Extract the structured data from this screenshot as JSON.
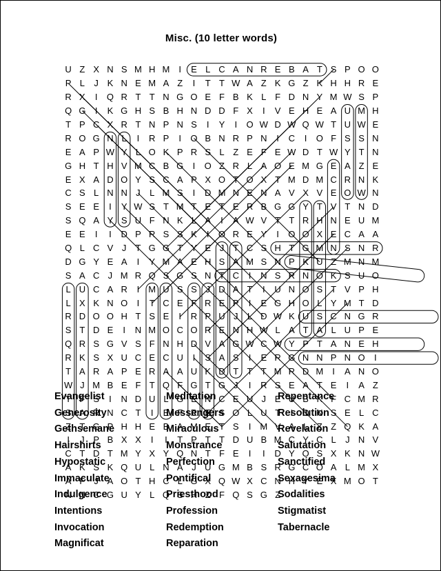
{
  "page": {
    "title": "Misc. (10 letter words)",
    "border_color": "#000000",
    "background_color": "#ffffff",
    "text_color": "#000000"
  },
  "grid": {
    "rows": 23,
    "columns": 23,
    "letters": [
      [
        "U",
        "Z",
        "X",
        "N",
        "S",
        "M",
        "H",
        "M",
        "I",
        "E",
        "L",
        "C",
        "A",
        "N",
        "R",
        "E",
        "B",
        "A",
        "T",
        "S",
        "P",
        "O",
        "O"
      ],
      [
        "N",
        "E",
        "M",
        "A",
        "Z",
        "I",
        "T",
        "T",
        "W",
        "A",
        "Z",
        "K",
        "G",
        "Z",
        "K",
        "H",
        "H",
        "R",
        "E",
        "R",
        "X",
        "I",
        "Q"
      ],
      [
        "G",
        "O",
        "E",
        "F",
        "B",
        "K",
        "L",
        "F",
        "D",
        "N",
        "Y",
        "M",
        "W",
        "S",
        "P",
        "Q",
        "G",
        "I",
        "K",
        "G",
        "H",
        "S",
        "B"
      ],
      [
        "F",
        "X",
        "I",
        "V",
        "E",
        "H",
        "E",
        "A",
        "U",
        "M",
        "H",
        "T",
        "P",
        "C",
        "X",
        "R",
        "T",
        "N",
        "P",
        "N",
        "S",
        "I",
        "Y"
      ],
      [
        "W",
        "Q",
        "W",
        "T",
        "U",
        "W",
        "E",
        "R",
        "O",
        "G",
        "N",
        "L",
        "I",
        "R",
        "P",
        "I",
        "O",
        "B",
        "N",
        "R",
        "P",
        "N",
        "I"
      ],
      [
        "S",
        "S",
        "N",
        "E",
        "A",
        "P",
        "W",
        "Y",
        "L",
        "O",
        "K",
        "P",
        "R",
        "S",
        "L",
        "Z",
        "E",
        "F",
        "E",
        "W",
        "D",
        "T",
        "W"
      ],
      [
        "H",
        "T",
        "H",
        "V",
        "M",
        "C",
        "B",
        "G",
        "I",
        "O",
        "Z",
        "R",
        "L",
        "A",
        "O",
        "E",
        "M",
        "G",
        "E",
        "A",
        "Z",
        "E",
        "E"
      ],
      [
        "Y",
        "S",
        "C",
        "A",
        "P",
        "X",
        "O",
        "T",
        "O",
        "X",
        "T",
        "M",
        "D",
        "M",
        "C",
        "R",
        "N",
        "K",
        "C",
        "S",
        "L",
        "N",
        "N"
      ],
      [
        "I",
        "D",
        "M",
        "N",
        "E",
        "N",
        "A",
        "V",
        "X",
        "V",
        "E",
        "O",
        "W",
        "N",
        "S",
        "E",
        "E",
        "I",
        "Y",
        "W",
        "S",
        "T",
        "M"
      ],
      [
        "R",
        "B",
        "G",
        "G",
        "Y",
        "T",
        "V",
        "T",
        "N",
        "D",
        "S",
        "Q",
        "A",
        "Y",
        "S",
        "U",
        "F",
        "N",
        "K",
        "L",
        "A",
        "I",
        "A"
      ],
      [
        "R",
        "H",
        "N",
        "E",
        "U",
        "M",
        "E",
        "E",
        "I",
        "I",
        "D",
        "P",
        "R",
        "S",
        "S",
        "K",
        "I",
        "O",
        "R",
        "E",
        "Y",
        "I",
        "O"
      ],
      [
        "A",
        "A",
        "Q",
        "L",
        "C",
        "V",
        "J",
        "T",
        "G",
        "G",
        "T",
        "Y",
        "E",
        "J",
        "T",
        "C",
        "S",
        "H",
        "T",
        "G",
        "M",
        "N",
        "S"
      ],
      [
        "Y",
        "E",
        "A",
        "I",
        "Y",
        "M",
        "A",
        "E",
        "H",
        "S",
        "A",
        "M",
        "S",
        "N",
        "P",
        "K",
        "U",
        "Z",
        "M",
        "N",
        "M",
        "S",
        "A"
      ],
      [
        "Q",
        "S",
        "G",
        "S",
        "N",
        "T",
        "C",
        "I",
        "N",
        "S",
        "R",
        "N",
        "O",
        "K",
        "S",
        "U",
        "O",
        "L",
        "U",
        "C",
        "A",
        "R",
        "I"
      ],
      [
        "J",
        "D",
        "A",
        "T",
        "I",
        "U",
        "N",
        "O",
        "S",
        "T",
        "V",
        "P",
        "H",
        "L",
        "X",
        "K",
        "N",
        "O",
        "I",
        "T",
        "C",
        "E",
        "F"
      ],
      [
        "E",
        "G",
        "H",
        "O",
        "L",
        "Y",
        "M",
        "T",
        "D",
        "R",
        "D",
        "O",
        "O",
        "H",
        "T",
        "S",
        "E",
        "I",
        "R",
        "P",
        "U",
        "J",
        "L"
      ],
      [
        "S",
        "C",
        "N",
        "G",
        "R",
        "S",
        "T",
        "D",
        "E",
        "I",
        "N",
        "M",
        "O",
        "C",
        "O",
        "R",
        "E",
        "N",
        "H",
        "W",
        "L",
        "A",
        "T"
      ],
      [
        "E",
        "Q",
        "R",
        "S",
        "G",
        "V",
        "S",
        "F",
        "N",
        "H",
        "D",
        "V",
        "A",
        "G",
        "W",
        "C",
        "W",
        "Y",
        "P",
        "T",
        "A",
        "N",
        "E"
      ],
      [
        "X",
        "U",
        "C",
        "E",
        "C",
        "U",
        "I",
        "S",
        "A",
        "S",
        "I",
        "E",
        "R",
        "G",
        "N",
        "N",
        "P",
        "N",
        "O",
        "I",
        "T",
        "A",
        "R"
      ],
      [
        "A",
        "A",
        "U",
        "K",
        "D",
        "T",
        "T",
        "T",
        "M",
        "R",
        "D",
        "M",
        "I",
        "A",
        "N",
        "O",
        "W",
        "J",
        "M",
        "B",
        "E",
        "F",
        "T"
      ],
      [
        "G",
        "J",
        "I",
        "R",
        "S",
        "E",
        "A",
        "T",
        "E",
        "I",
        "A",
        "Z",
        "T",
        "F",
        "S",
        "I",
        "N",
        "D",
        "U",
        "L",
        "G",
        "E",
        "N"
      ],
      [
        "E",
        "U",
        "B",
        "K",
        "F",
        "C",
        "M",
        "R",
        "S",
        "A",
        "R",
        "N",
        "C",
        "T",
        "I",
        "E",
        "F",
        "R",
        "E",
        "S",
        "O",
        "L",
        "U"
      ],
      [
        "S",
        "E",
        "L",
        "C",
        "Z",
        "T",
        "G",
        "P",
        "H",
        "H",
        "E",
        "B",
        "A",
        "M",
        "E",
        "T",
        "S",
        "I",
        "M",
        "V",
        "A",
        "L",
        "Z"
      ],
      [
        "I",
        "J",
        "P",
        "B",
        "X",
        "X",
        "I",
        "I",
        "T",
        "P",
        "T",
        "T",
        "D",
        "U",
        "B",
        "M",
        "C",
        "Y",
        "C",
        "L",
        "J",
        "N",
        "V"
      ],
      [
        "M",
        "Y",
        "X",
        "Y",
        "Q",
        "N",
        "T",
        "F",
        "E",
        "I",
        "I",
        "D",
        "Y",
        "O",
        "S",
        "X",
        "K",
        "N",
        "W",
        "A",
        "K",
        "S",
        "K"
      ],
      [
        "A",
        "J",
        "U",
        "G",
        "M",
        "B",
        "S",
        "R",
        "G",
        "C",
        "O",
        "A",
        "L",
        "M",
        "X",
        "A",
        "F",
        "J",
        "A",
        "O",
        "T",
        "H",
        "C"
      ],
      [
        "W",
        "X",
        "C",
        "N",
        "H",
        "Y",
        "E",
        "X",
        "M",
        "O",
        "T",
        "N",
        "N",
        "C",
        "G",
        "U",
        "Y",
        "L",
        "Q",
        "S",
        "H",
        "Z",
        "F"
      ]
    ],
    "letters_tail": [
      [
        "P",
        "L",
        "J",
        "K"
      ],
      [
        "R",
        "T",
        "T",
        "N"
      ],
      [
        "H",
        "N",
        "D",
        "D"
      ],
      [
        "I",
        "O",
        "W",
        "D"
      ],
      [
        "C",
        "I",
        "O",
        "F"
      ],
      [
        "Y",
        "T",
        "N",
        "G"
      ],
      [
        "X",
        "A",
        "D",
        "O"
      ],
      [
        "J",
        "L",
        "M",
        "S"
      ],
      [
        "T",
        "E",
        "T",
        "E"
      ],
      [
        "W",
        "V",
        "T",
        "T"
      ],
      [
        "O",
        "X",
        "E",
        "C"
      ],
      [
        "N",
        "R",
        "D",
        "G"
      ],
      [
        "C",
        "J",
        "M",
        "R"
      ],
      [
        "M",
        "U",
        "S",
        "S"
      ],
      [
        "R",
        "E",
        "P",
        "I"
      ],
      [
        "D",
        "W",
        "K",
        "U"
      ],
      [
        "A",
        "L",
        "U",
        "P"
      ],
      [
        "H",
        "R",
        "K",
        "S"
      ],
      [
        "A",
        "P",
        "E",
        "R"
      ],
      [
        "Q",
        "F",
        "G",
        "T"
      ],
      [
        "C",
        "E",
        "U",
        "J"
      ],
      [
        "T",
        "I",
        "O",
        "N"
      ],
      [
        "Z",
        "Q",
        "K",
        "A"
      ],
      [
        "C",
        "T",
        "D",
        "T"
      ],
      [
        "Q",
        "U",
        "L",
        "N"
      ],
      [
        "L",
        "G",
        "X",
        "Q"
      ],
      [
        "Q",
        "S",
        "G",
        "Z"
      ]
    ]
  },
  "word_list": {
    "columns": [
      {
        "name": "column-1",
        "words": [
          "Evangelist",
          "Generosity",
          "Gethsemane",
          "Hairshirts",
          "Hypostatic",
          "Immaculate",
          "Indulgence",
          "Intentions",
          "Invocation",
          "Magnificat"
        ]
      },
      {
        "name": "column-2",
        "words": [
          "Meditation",
          "Messengers",
          "Miraculous",
          "Monstrance",
          "Perfection",
          "Pontifical",
          "Priesthood",
          "Profession",
          "Redemption",
          "Reparation"
        ]
      },
      {
        "name": "column-3",
        "words": [
          "Repentance",
          "Resolution",
          "Revelation",
          "Salutation",
          "Sanctified",
          "Sexagesima",
          "Sodalities",
          "Stigmatist",
          "Tabernacle"
        ]
      }
    ]
  },
  "solution_marks": {
    "description": "Oval outlines and straight strike-through lines drawn over found words in the grid",
    "stroke_color": "#000000",
    "stroke_width": 1,
    "ovals": [
      {
        "word": "TABERNACLE",
        "r1": 0,
        "c1": 18,
        "r2": 0,
        "c2": 9
      },
      {
        "word": "MIRACULOUS",
        "r1": 13,
        "c1": 22,
        "r2": 13,
        "c2": 15
      },
      {
        "word": "PERFECTION",
        "r1": 15,
        "c1": 25,
        "r2": 14,
        "c2": 16
      },
      {
        "word": "PRIESTHOOD",
        "r1": 15,
        "c1": 19,
        "r2": 15,
        "c2": 11
      },
      {
        "word": "REPARATION",
        "r1": 18,
        "c1": 26,
        "r2": 18,
        "c2": 17
      },
      {
        "word": "INDULGENCE",
        "r1": 20,
        "c1": 16,
        "r2": 20,
        "c2": 25
      },
      {
        "word": "RESOLUTION",
        "r1": 21,
        "c1": 17,
        "r2": 21,
        "c2": 26
      }
    ],
    "vertical_lines": [
      {
        "col": 3,
        "r1": 5,
        "r2": 11
      },
      {
        "col": 4,
        "r1": 5,
        "r2": 11
      },
      {
        "col": 20,
        "r1": 3,
        "r2": 9
      },
      {
        "col": 21,
        "r1": 3,
        "r2": 9
      },
      {
        "col": 19,
        "r1": 7,
        "r2": 13
      },
      {
        "col": 0,
        "r1": 16,
        "r2": 25
      },
      {
        "col": 1,
        "r1": 16,
        "r2": 25
      },
      {
        "col": 6,
        "r1": 16,
        "r2": 25
      },
      {
        "col": 7,
        "r1": 16,
        "r2": 25
      },
      {
        "col": 9,
        "r1": 16,
        "r2": 25
      },
      {
        "col": 10,
        "r1": 16,
        "r2": 25
      },
      {
        "col": 11,
        "r1": 13,
        "r2": 22
      },
      {
        "col": 12,
        "r1": 13,
        "r2": 22
      },
      {
        "col": 17,
        "r1": 10,
        "r2": 19
      },
      {
        "col": 18,
        "r1": 10,
        "r2": 19
      }
    ],
    "diagonal_lines": [
      {
        "r1": 1,
        "c1": 0,
        "r2": 10,
        "c2": 9
      },
      {
        "r1": 2,
        "c1": 1,
        "r2": 11,
        "c2": 10
      },
      {
        "r1": 3,
        "c1": 1,
        "r2": 12,
        "c2": 10
      },
      {
        "r1": 4,
        "c1": 2,
        "r2": 13,
        "c2": 11
      },
      {
        "r1": 5,
        "c1": 4,
        "r2": 14,
        "c2": 13
      },
      {
        "r1": 3,
        "c1": 17,
        "r2": 12,
        "c2": 8
      },
      {
        "r1": 2,
        "c1": 18,
        "r2": 11,
        "c2": 9
      },
      {
        "r1": 4,
        "c1": 16,
        "r2": 13,
        "c2": 7
      },
      {
        "r1": 6,
        "c1": 16,
        "r2": 15,
        "c2": 7
      },
      {
        "r1": 7,
        "c1": 16,
        "r2": 16,
        "c2": 7
      },
      {
        "r1": 5,
        "c1": 9,
        "r2": 14,
        "c2": 18
      },
      {
        "r1": 6,
        "c1": 7,
        "r2": 15,
        "c2": 16
      },
      {
        "r1": 8,
        "c1": 6,
        "r2": 17,
        "c2": 15
      },
      {
        "r1": 9,
        "c1": 5,
        "r2": 18,
        "c2": 14
      },
      {
        "r1": 10,
        "c1": 4,
        "r2": 19,
        "c2": 13
      },
      {
        "r1": 11,
        "c1": 3,
        "r2": 20,
        "c2": 12
      },
      {
        "r1": 7,
        "c1": 14,
        "r2": 16,
        "c2": 5
      },
      {
        "r1": 8,
        "c1": 15,
        "r2": 17,
        "c2": 6
      },
      {
        "r1": 9,
        "c1": 17,
        "r2": 18,
        "c2": 8
      },
      {
        "r1": 10,
        "c1": 19,
        "r2": 19,
        "c2": 10
      },
      {
        "r1": 12,
        "c1": 19,
        "r2": 21,
        "c2": 10
      },
      {
        "r1": 13,
        "c1": 20,
        "r2": 22,
        "c2": 11
      },
      {
        "r1": 16,
        "c1": 19,
        "r2": 25,
        "c2": 10
      },
      {
        "r1": 17,
        "c1": 20,
        "r2": 26,
        "c2": 11
      },
      {
        "r1": 18,
        "c1": 12,
        "r2": 26,
        "c2": 20
      },
      {
        "r1": 19,
        "c1": 11,
        "r2": 26,
        "c2": 18
      },
      {
        "r1": 20,
        "c1": 9,
        "r2": 26,
        "c2": 15
      },
      {
        "r1": 21,
        "c1": 9,
        "r2": 26,
        "c2": 14
      },
      {
        "r1": 22,
        "c1": 7,
        "r2": 26,
        "c2": 11
      },
      {
        "r1": 23,
        "c1": 8,
        "r2": 26,
        "c2": 11
      },
      {
        "r1": 16,
        "c1": 11,
        "r2": 24,
        "c2": 19
      },
      {
        "r1": 0,
        "c1": 19,
        "r2": 1,
        "c2": 18
      }
    ]
  }
}
